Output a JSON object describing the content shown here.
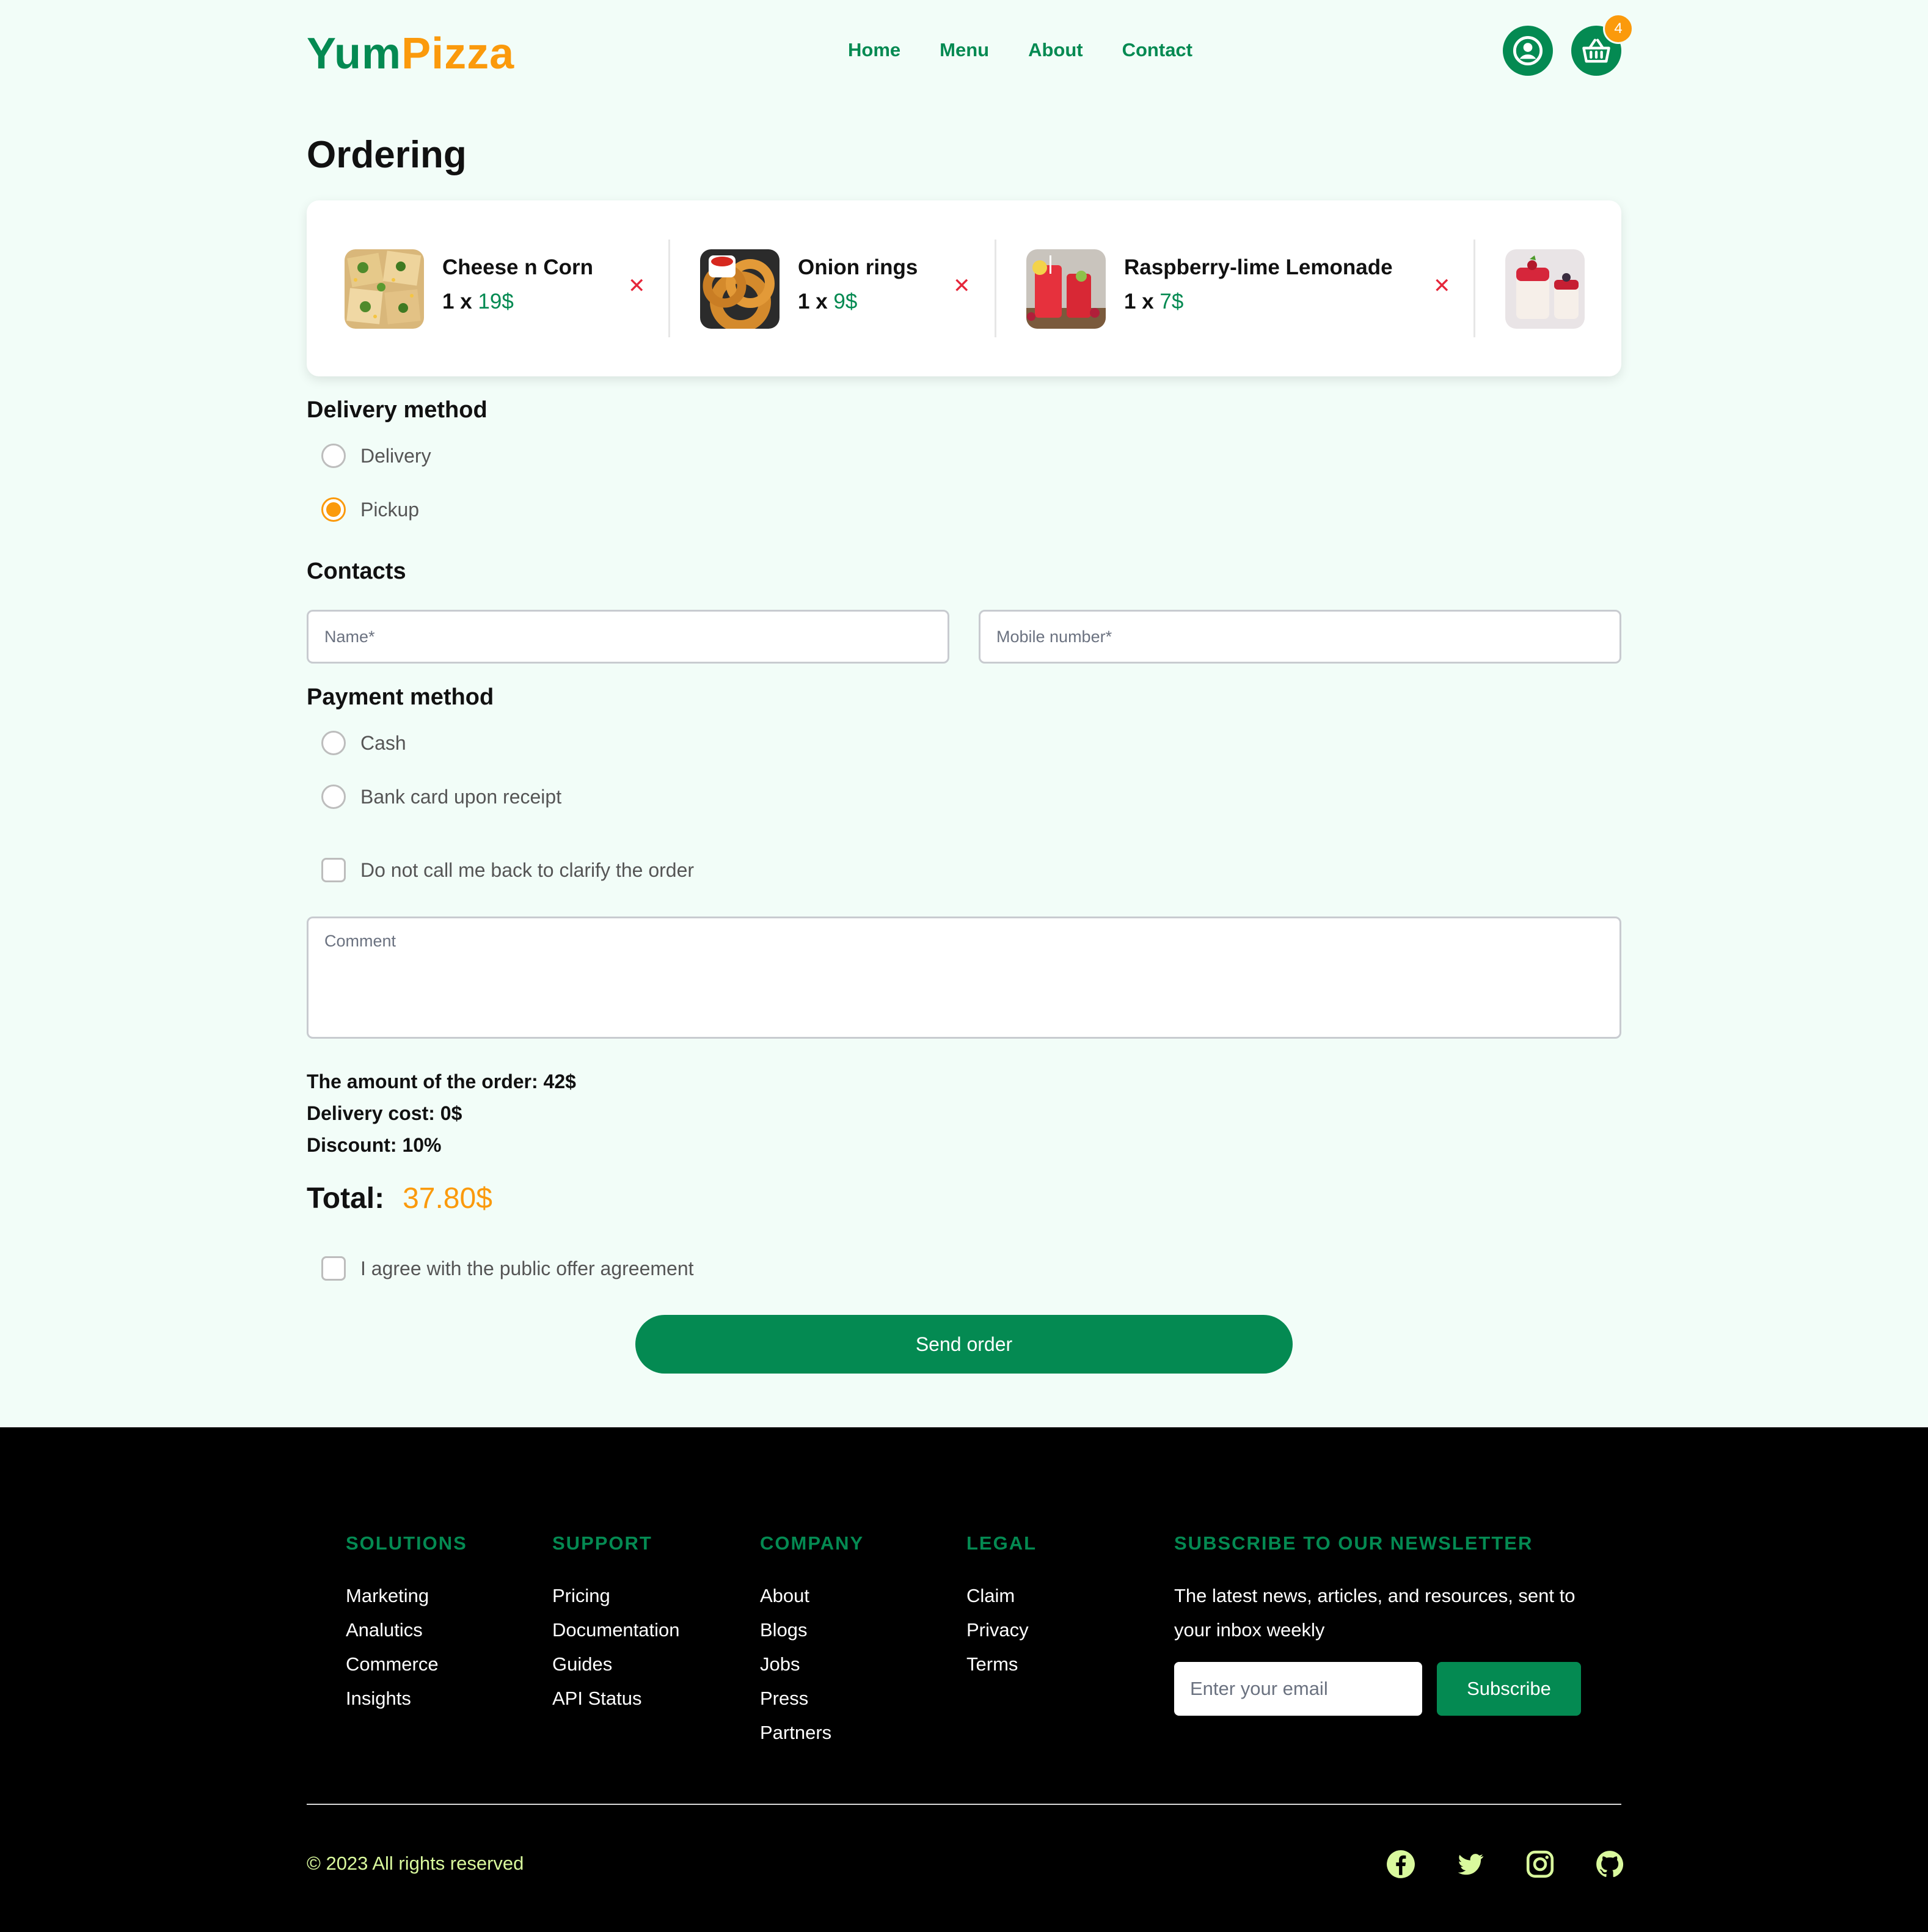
{
  "brand": {
    "part1": "Yum",
    "part2": "Pizza"
  },
  "nav": {
    "items": [
      "Home",
      "Menu",
      "About",
      "Contact"
    ]
  },
  "cart": {
    "count": "4"
  },
  "page": {
    "title": "Ordering"
  },
  "order_items": [
    {
      "name": "Cheese n Corn",
      "qty_prefix": "1 x ",
      "price": "19$"
    },
    {
      "name": "Onion rings",
      "qty_prefix": "1 x ",
      "price": "9$"
    },
    {
      "name": "Raspberry-lime Lemonade",
      "qty_prefix": "1 x ",
      "price": "7$"
    }
  ],
  "delivery": {
    "title": "Delivery method",
    "options": [
      "Delivery",
      "Pickup"
    ],
    "selected": "Pickup"
  },
  "contacts": {
    "title": "Contacts",
    "name_placeholder": "Name*",
    "mobile_placeholder": "Mobile number*"
  },
  "payment": {
    "title": "Payment method",
    "options": [
      "Cash",
      "Bank card upon receipt"
    ],
    "no_callback_label": "Do not call me back to clarify the order"
  },
  "comment": {
    "placeholder": "Comment"
  },
  "summary": {
    "amount": "The amount of the order: 42$",
    "delivery_cost": "Delivery cost: 0$",
    "discount": "Discount: 10%",
    "total_label": "Total:",
    "total_value": "37.80$"
  },
  "agreement": {
    "label": "I agree with the public offer agreement"
  },
  "send_button": "Send order",
  "footer": {
    "columns": [
      {
        "title": "SOLUTIONS",
        "links": [
          "Marketing",
          "Analutics",
          "Commerce",
          "Insights"
        ]
      },
      {
        "title": "SUPPORT",
        "links": [
          "Pricing",
          "Documentation",
          "Guides",
          "API Status"
        ]
      },
      {
        "title": "COMPANY",
        "links": [
          "About",
          "Blogs",
          "Jobs",
          "Press",
          "Partners"
        ]
      },
      {
        "title": "LEGAL",
        "links": [
          "Claim",
          "Privacy",
          "Terms"
        ]
      }
    ],
    "newsletter": {
      "title": "SUBSCRIBE TO OUR NEWSLETTER",
      "text": "The latest news, articles, and resources, sent to your inbox weekly",
      "email_placeholder": "Enter your email",
      "button": "Subscribe"
    },
    "copyright": "© 2023 All rights reserved",
    "socials": [
      "facebook-icon",
      "twitter-icon",
      "instagram-icon",
      "github-icon"
    ]
  },
  "colors": {
    "brand_green": "#048a52",
    "accent_orange": "#fb9a0c",
    "remove_red": "#e6263a",
    "page_bg": "#f2fdf8"
  }
}
